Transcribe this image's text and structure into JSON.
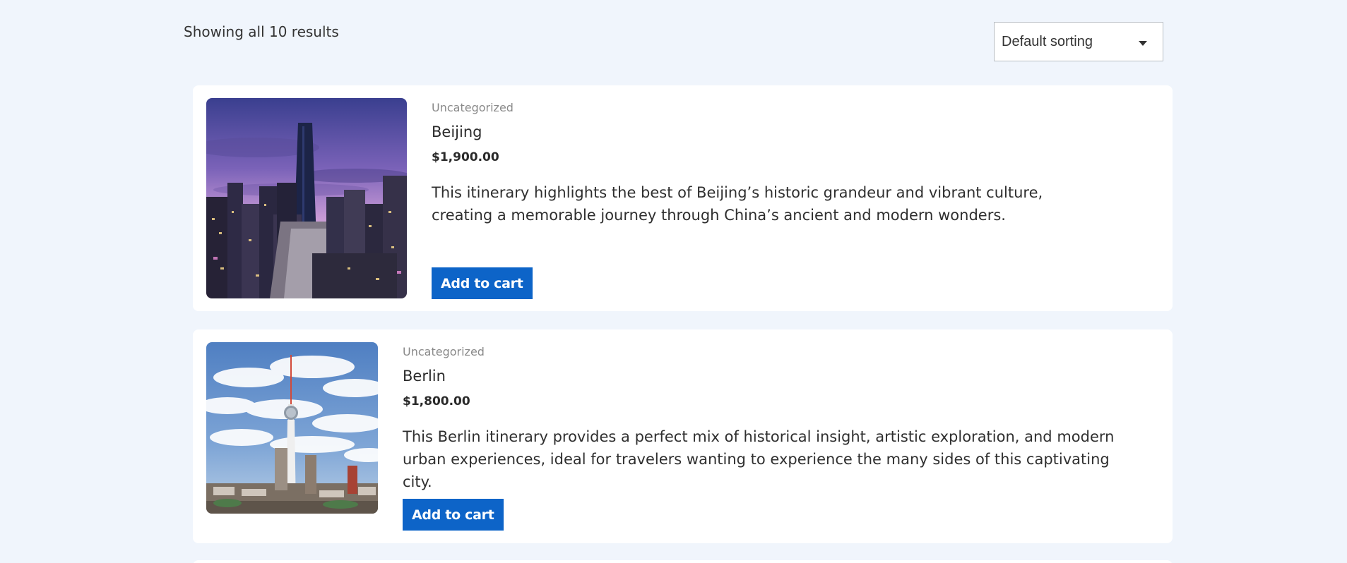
{
  "results": {
    "text": "Showing all 10 results"
  },
  "sorting": {
    "selected": "Default sorting"
  },
  "products": [
    {
      "category": "Uncategorized",
      "title": "Beijing",
      "price": "$1,900.00",
      "description": "This itinerary highlights the best of Beijing’s historic grandeur and vibrant culture, creating a memorable journey through China’s ancient and modern wonders.",
      "button": "Add to cart"
    },
    {
      "category": "Uncategorized",
      "title": "Berlin",
      "price": "$1,800.00",
      "description": "This Berlin itinerary provides a perfect mix of historical insight, artistic exploration, and modern urban experiences, ideal for travelers wanting to experience the many sides of this captivating city.",
      "button": "Add to cart"
    }
  ],
  "colors": {
    "background": "#f0f5fc",
    "button": "#0d64c8",
    "category_text": "#8a8a8a"
  },
  "icons": {
    "sort_caret": "caret-down-icon"
  }
}
